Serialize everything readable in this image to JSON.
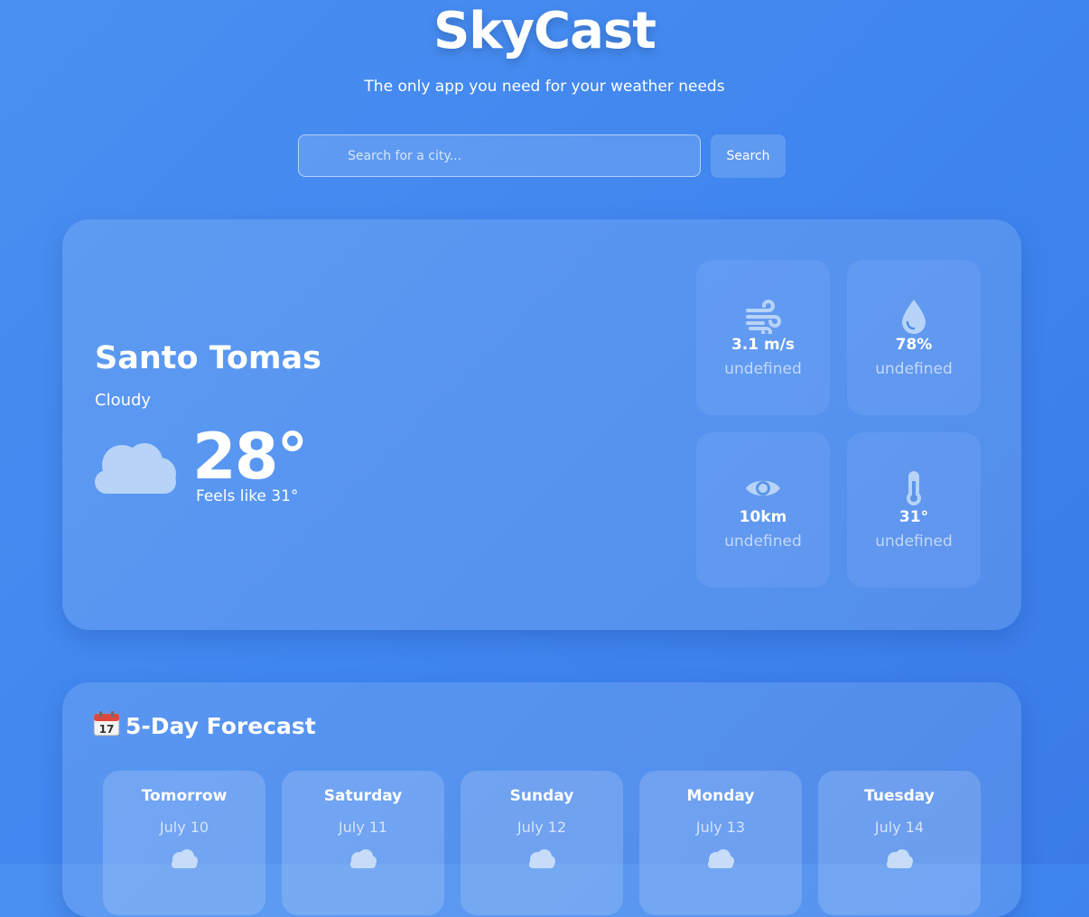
{
  "header": {
    "title": "SkyCast",
    "tagline": "The only app you need for your weather needs"
  },
  "search": {
    "placeholder": "Search for a city...",
    "value": "",
    "button_label": "Search"
  },
  "current": {
    "city": "Santo Tomas",
    "condition": "Cloudy",
    "condition_icon": "cloud-icon",
    "temperature": "28°",
    "feels_like": "Feels like 31°",
    "stats": [
      {
        "icon": "wind-icon",
        "value": "3.1 m/s",
        "label": "undefined"
      },
      {
        "icon": "humidity-drop-icon",
        "value": "78%",
        "label": "undefined"
      },
      {
        "icon": "eye-icon",
        "value": "10km",
        "label": "undefined"
      },
      {
        "icon": "thermometer-icon",
        "value": "31°",
        "label": "undefined"
      }
    ]
  },
  "forecast": {
    "title": "5-Day Forecast",
    "title_icon": "calendar-icon",
    "days": [
      {
        "name": "Tomorrow",
        "date": "July 10",
        "icon": "cloud-icon"
      },
      {
        "name": "Saturday",
        "date": "July 11",
        "icon": "cloud-icon"
      },
      {
        "name": "Sunday",
        "date": "July 12",
        "icon": "cloud-icon"
      },
      {
        "name": "Monday",
        "date": "July 13",
        "icon": "cloud-icon"
      },
      {
        "name": "Tuesday",
        "date": "July 14",
        "icon": "cloud-icon"
      }
    ]
  },
  "colors": {
    "background": "#4086ef",
    "icon_tint": "#b7d3f7",
    "text": "#ffffff"
  }
}
